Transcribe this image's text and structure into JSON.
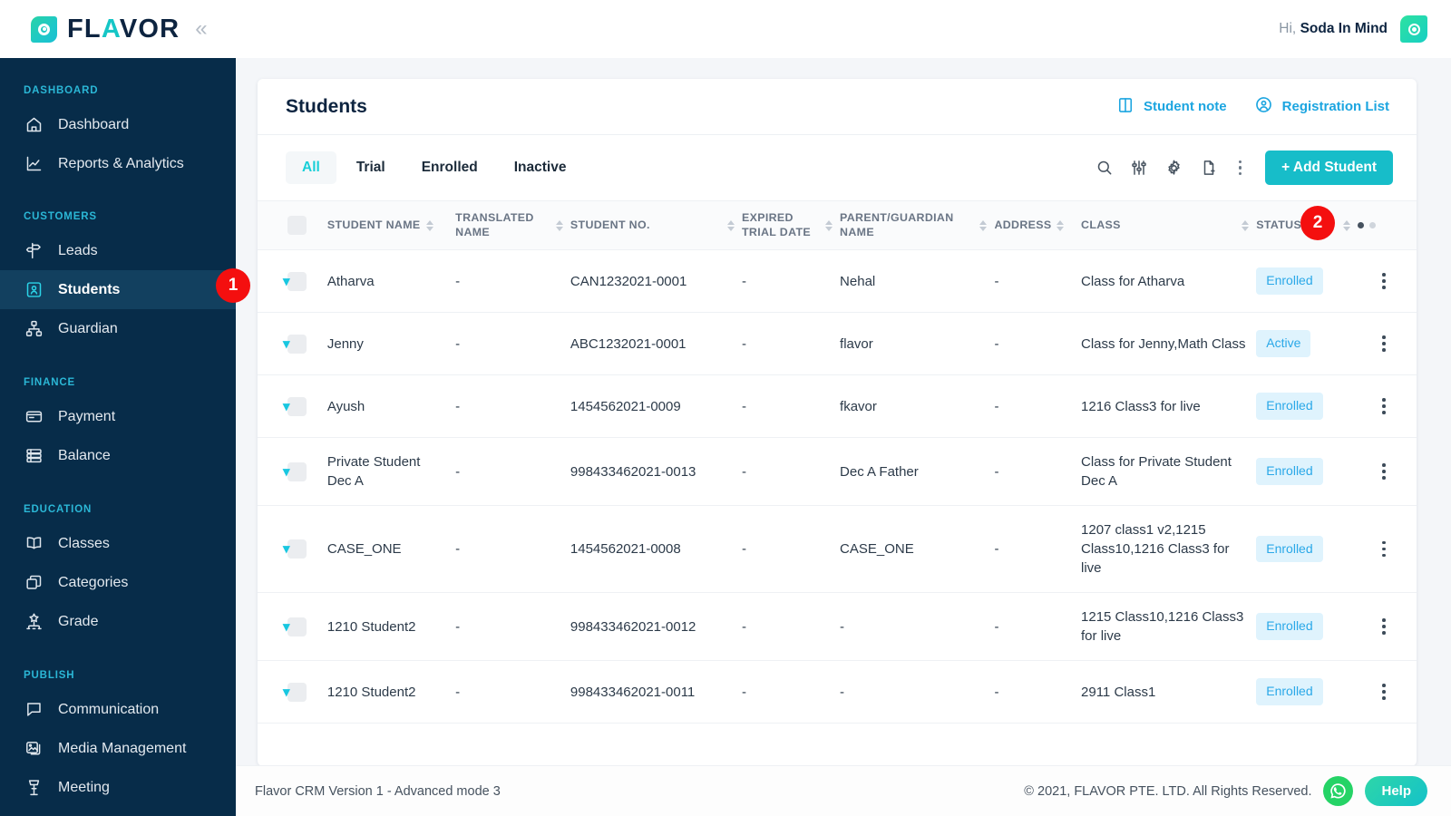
{
  "brand": {
    "name_part1": "FL",
    "name_accent": "A",
    "name_part2": "VOR",
    "collapse_icon": "chevron-double-left-icon"
  },
  "topbar": {
    "greeting_prefix": "Hi,",
    "user_name": "Soda In Mind",
    "avatar_icon": "user-avatar-icon"
  },
  "sidebar": {
    "groups": [
      {
        "label": "DASHBOARD",
        "items": [
          {
            "label": "Dashboard",
            "icon": "home-icon",
            "active": false
          },
          {
            "label": "Reports & Analytics",
            "icon": "chart-line-icon",
            "active": false
          }
        ]
      },
      {
        "label": "CUSTOMERS",
        "items": [
          {
            "label": "Leads",
            "icon": "signpost-icon",
            "active": false
          },
          {
            "label": "Students",
            "icon": "student-card-icon",
            "active": true
          },
          {
            "label": "Guardian",
            "icon": "guardian-hierarchy-icon",
            "active": false
          }
        ]
      },
      {
        "label": "FINANCE",
        "items": [
          {
            "label": "Payment",
            "icon": "credit-card-icon",
            "active": false
          },
          {
            "label": "Balance",
            "icon": "coins-stack-icon",
            "active": false
          }
        ]
      },
      {
        "label": "EDUCATION",
        "items": [
          {
            "label": "Classes",
            "icon": "open-book-icon",
            "active": false
          },
          {
            "label": "Categories",
            "icon": "layers-box-icon",
            "active": false
          },
          {
            "label": "Grade",
            "icon": "grade-network-icon",
            "active": false
          }
        ]
      },
      {
        "label": "PUBLISH",
        "items": [
          {
            "label": "Communication",
            "icon": "chat-bubble-icon",
            "active": false
          },
          {
            "label": "Media Management",
            "icon": "image-stack-icon",
            "active": false
          },
          {
            "label": "Meeting",
            "icon": "podium-icon",
            "active": false
          }
        ]
      }
    ]
  },
  "step_badges": [
    {
      "number": "1",
      "target": "sidebar-item-students"
    },
    {
      "number": "2",
      "target": "add-student-button"
    }
  ],
  "card": {
    "title": "Students",
    "head_links": [
      {
        "label": "Student note",
        "icon": "notebook-icon"
      },
      {
        "label": "Registration List",
        "icon": "user-circle-icon"
      }
    ]
  },
  "toolbar": {
    "tabs": [
      {
        "label": "All",
        "active": true
      },
      {
        "label": "Trial",
        "active": false
      },
      {
        "label": "Enrolled",
        "active": false
      },
      {
        "label": "Inactive",
        "active": false
      }
    ],
    "icons": [
      "search-icon",
      "filter-sliders-icon",
      "gear-icon",
      "document-add-icon",
      "kebab-menu-icon"
    ],
    "add_button_label": "+ Add Student"
  },
  "table": {
    "columns": [
      {
        "key": "expand",
        "label": "",
        "sortable": false
      },
      {
        "key": "checkbox",
        "label": "",
        "sortable": false
      },
      {
        "key": "student_name",
        "label": "STUDENT NAME",
        "sortable": true
      },
      {
        "key": "translated_name",
        "label": "TRANSLATED NAME",
        "sortable": true
      },
      {
        "key": "student_no",
        "label": "STUDENT NO.",
        "sortable": true
      },
      {
        "key": "expired_trial_date",
        "label": "EXPIRED TRIAL DATE",
        "sortable": true
      },
      {
        "key": "parent_guardian_name",
        "label": "PARENT/GUARDIAN NAME",
        "sortable": true
      },
      {
        "key": "address",
        "label": "ADDRESS",
        "sortable": true
      },
      {
        "key": "class",
        "label": "CLASS",
        "sortable": true
      },
      {
        "key": "status",
        "label": "STATUS",
        "sortable": true
      },
      {
        "key": "actions",
        "label": "",
        "sortable": false
      }
    ],
    "page_dots": {
      "total": 2,
      "active_index": 0
    },
    "rows": [
      {
        "student_name": "Atharva",
        "translated_name": "-",
        "student_no": "CAN1232021-0001",
        "expired_trial_date": "-",
        "parent_guardian_name": "Nehal",
        "address": "-",
        "class": "Class for Atharva",
        "status": "Enrolled"
      },
      {
        "student_name": "Jenny",
        "translated_name": "-",
        "student_no": "ABC1232021-0001",
        "expired_trial_date": "-",
        "parent_guardian_name": "flavor",
        "address": "-",
        "class": "Class for Jenny,Math Class",
        "status": "Active"
      },
      {
        "student_name": "Ayush",
        "translated_name": "-",
        "student_no": "1454562021-0009",
        "expired_trial_date": "-",
        "parent_guardian_name": "fkavor",
        "address": "-",
        "class": "1216 Class3 for live",
        "status": "Enrolled"
      },
      {
        "student_name": "Private Student Dec A",
        "translated_name": "-",
        "student_no": "998433462021-0013",
        "expired_trial_date": "-",
        "parent_guardian_name": "Dec A Father",
        "address": "-",
        "class": "Class for Private Student Dec A",
        "status": "Enrolled"
      },
      {
        "student_name": "CASE_ONE",
        "translated_name": "-",
        "student_no": "1454562021-0008",
        "expired_trial_date": "-",
        "parent_guardian_name": "CASE_ONE",
        "address": "-",
        "class": "1207 class1 v2,1215 Class10,1216 Class3 for live",
        "status": "Enrolled"
      },
      {
        "student_name": "1210 Student2",
        "translated_name": "-",
        "student_no": "998433462021-0012",
        "expired_trial_date": "-",
        "parent_guardian_name": "-",
        "address": "-",
        "class": "1215 Class10,1216 Class3 for live",
        "status": "Enrolled"
      },
      {
        "student_name": "1210 Student2",
        "translated_name": "-",
        "student_no": "998433462021-0011",
        "expired_trial_date": "-",
        "parent_guardian_name": "-",
        "address": "-",
        "class": "2911 Class1",
        "status": "Enrolled"
      }
    ]
  },
  "footer": {
    "version_text": "Flavor CRM Version 1 - Advanced mode 3",
    "copyright": "© 2021, FLAVOR PTE. LTD. All Rights Reserved.",
    "whatsapp_icon": "whatsapp-icon",
    "help_label": "Help"
  },
  "colors": {
    "sidebar_bg": "#072c49",
    "sidebar_active": "#12405f",
    "group_label": "#2bb7d6",
    "accent_teal": "#17bdc9",
    "link_blue": "#1ca5e0",
    "badge_red": "#f40f0f",
    "pill_bg": "#dff3fd",
    "pill_text": "#2aa8e8",
    "title_navy": "#0d2440",
    "whatsapp_green": "#25d366"
  }
}
